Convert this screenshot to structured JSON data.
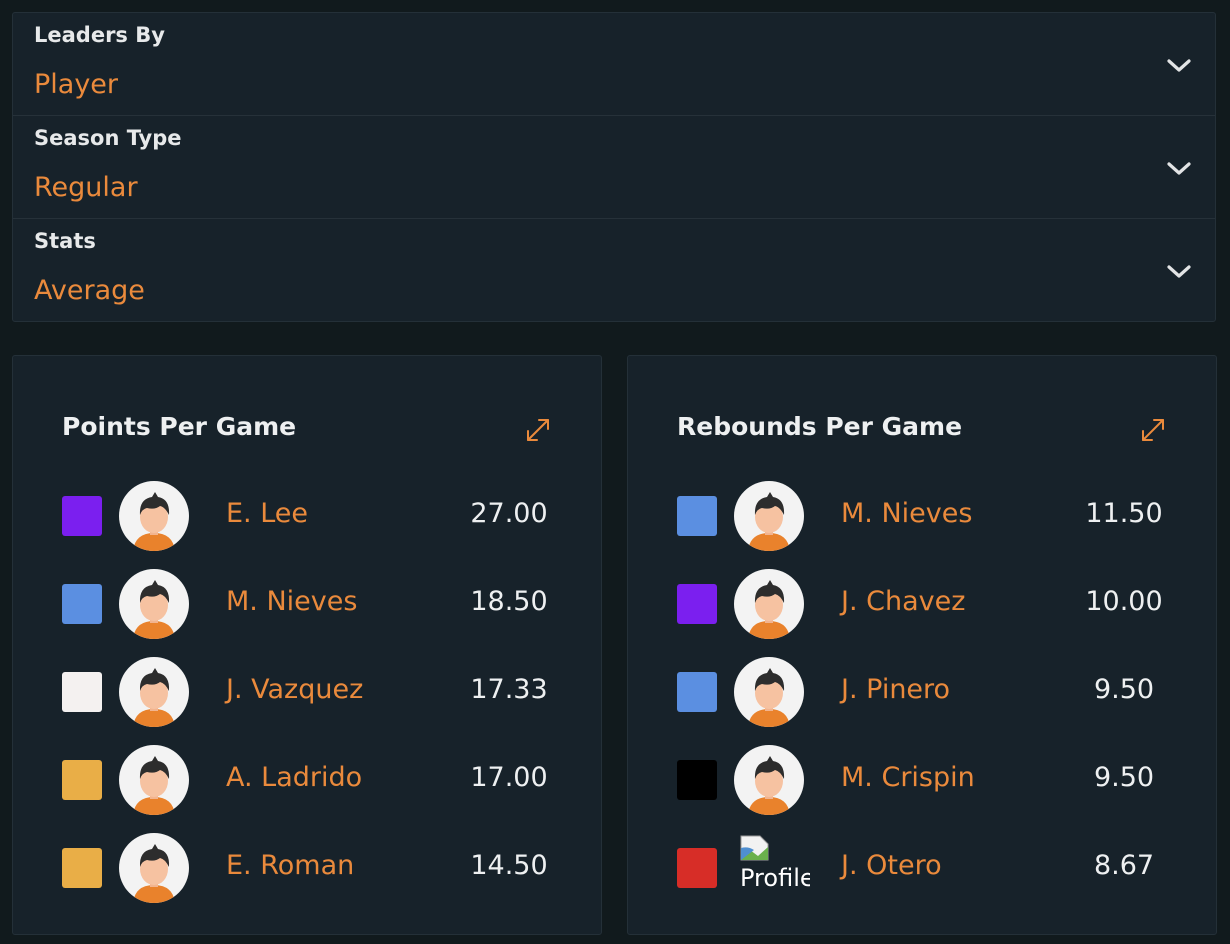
{
  "filters": [
    {
      "label": "Leaders By",
      "value": "Player",
      "icon": "chevron-down-icon"
    },
    {
      "label": "Season Type",
      "value": "Regular",
      "icon": "chevron-down-icon"
    },
    {
      "label": "Stats",
      "value": "Average",
      "icon": "chevron-down-icon"
    }
  ],
  "cards": [
    {
      "title": "Points Per Game",
      "expand_icon": "expand-icon",
      "players": [
        {
          "name": "E. Lee",
          "value": "27.00",
          "team_color": "#7b1fef",
          "avatar": "default-avatar-icon"
        },
        {
          "name": "M. Nieves",
          "value": "18.50",
          "team_color": "#5b8fe1",
          "avatar": "default-avatar-icon"
        },
        {
          "name": "J. Vazquez",
          "value": "17.33",
          "team_color": "#f4f1f0",
          "avatar": "default-avatar-icon"
        },
        {
          "name": "A. Ladrido",
          "value": "17.00",
          "team_color": "#e9ae47",
          "avatar": "default-avatar-icon"
        },
        {
          "name": "E. Roman",
          "value": "14.50",
          "team_color": "#e9ae47",
          "avatar": "default-avatar-icon"
        }
      ]
    },
    {
      "title": "Rebounds Per Game",
      "expand_icon": "expand-icon",
      "players": [
        {
          "name": "M. Nieves",
          "value": "11.50",
          "team_color": "#5b8fe1",
          "avatar": "default-avatar-icon"
        },
        {
          "name": "J. Chavez",
          "value": "10.00",
          "team_color": "#7b1fef",
          "avatar": "default-avatar-icon"
        },
        {
          "name": "J. Pinero",
          "value": "9.50",
          "team_color": "#5b8fe1",
          "avatar": "default-avatar-icon"
        },
        {
          "name": "M. Crispin",
          "value": "9.50",
          "team_color": "#000000",
          "avatar": "default-avatar-icon"
        },
        {
          "name": "J. Otero",
          "value": "8.67",
          "team_color": "#d72d27",
          "avatar": "broken-image-icon",
          "avatar_alt": "Profile"
        }
      ]
    }
  ],
  "colors": {
    "accent": "#ea8a3c",
    "background": "#111a1d",
    "panel": "#17222a"
  }
}
